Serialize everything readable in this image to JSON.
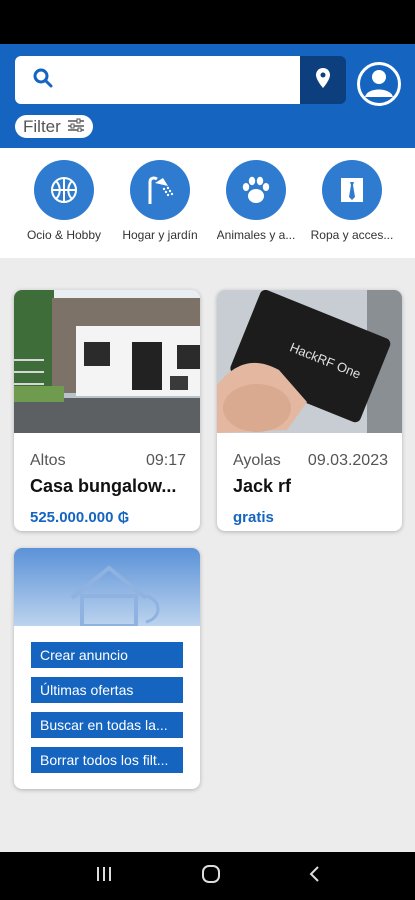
{
  "search": {
    "placeholder": "",
    "value": ""
  },
  "filter": {
    "label": "Filter"
  },
  "categories": [
    {
      "label": "Ocio & Hobby",
      "icon": "basketball-icon"
    },
    {
      "label": "Hogar y jardín",
      "icon": "shower-icon"
    },
    {
      "label": "Animales y a...",
      "icon": "paw-icon"
    },
    {
      "label": "Ropa y acces...",
      "icon": "tie-icon"
    }
  ],
  "listings": [
    {
      "location": "Altos",
      "time": "09:17",
      "title": "Casa bungalow...",
      "price": "525.000.000 ₲"
    },
    {
      "location": "Ayolas",
      "time": "09.03.2023",
      "title": "Jack rf",
      "price": "gratis"
    }
  ],
  "product_image_text": {
    "brand": "HackRF One"
  },
  "actions": [
    {
      "label": "Crear anuncio"
    },
    {
      "label": "Últimas ofertas"
    },
    {
      "label": "Buscar en todas la..."
    },
    {
      "label": "Borrar todos los filt..."
    }
  ],
  "colors": {
    "primary": "#1565c0",
    "dark_primary": "#0d3f7e",
    "category_circle": "#2e7bd0"
  }
}
